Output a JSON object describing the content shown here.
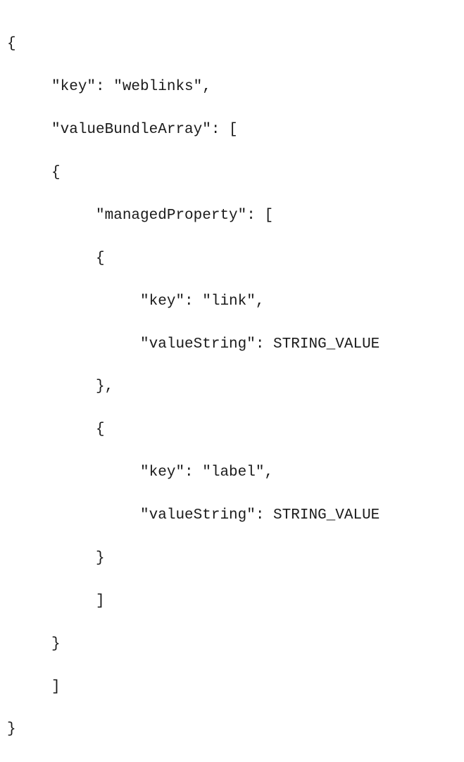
{
  "code": {
    "l1": "{",
    "l2": "     \"key\": \"weblinks\",",
    "l3": "     \"valueBundleArray\": [",
    "l4": "     {",
    "l5": "          \"managedProperty\": [",
    "l6": "          {",
    "l7": "               \"key\": \"link\",",
    "l8": "               \"valueString\": STRING_VALUE",
    "l9": "          },",
    "l10": "          {",
    "l11": "               \"key\": \"label\",",
    "l12": "               \"valueString\": STRING_VALUE",
    "l13": "          }",
    "l14": "          ]",
    "l15": "     }",
    "l16": "     ]",
    "l17": "}"
  }
}
